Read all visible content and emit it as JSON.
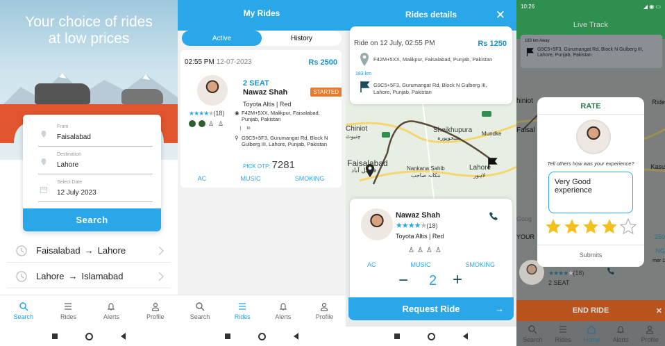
{
  "screen1": {
    "hero_title_line1": "Your choice of rides",
    "hero_title_line2": "at low prices",
    "from_label": "From",
    "from_value": "Faisalabad",
    "destination_label": "Destination",
    "destination_value": "Lahore",
    "date_label": "Select Date",
    "date_value": "12 July 2023",
    "search_button": "Search",
    "recent": [
      {
        "from": "Faisalabad",
        "to": "Lahore"
      },
      {
        "from": "Lahore",
        "to": "Islamabad"
      }
    ],
    "tabs": [
      "Search",
      "Rides",
      "Alerts",
      "Profile"
    ]
  },
  "screen2": {
    "title": "My Rides",
    "seg_active": "Active",
    "seg_history": "History",
    "time": "02:55 PM",
    "date": "12-07-2023",
    "price": "Rs 2500",
    "seats": "2 SEAT",
    "driver": "Nawaz Shah",
    "status": "STARTED",
    "car": "Toyota Altis  |  Red",
    "rating_count": "(18)",
    "from_addr": "F42M+5XX, Malikpur, Faisalabad, Punjab, Pakistan",
    "to_word": "to",
    "to_addr": "G9C5+5F3, Gurumangat Rd, Block N Gulberg III, Lahore, Punjab, Pakistan",
    "otp_label": "PICK OTP:",
    "otp_value": "7281",
    "features": [
      "AC",
      "MUSIC",
      "SMOKING"
    ],
    "tabs": [
      "Search",
      "Rides",
      "Alerts",
      "Profile"
    ]
  },
  "screen3": {
    "title": "Rides details",
    "ride_on": "Ride on 12 July, 02:55 PM",
    "price": "Rs 1250",
    "from_addr": "F42M+5XX, Malikpur, Faisalabad, Punjab, Pakistan",
    "distance": "183 km",
    "to_addr": "G9C5+5F3, Gurumangat Rd, Block N Gulberg III, Lahore, Punjab, Pakistan",
    "map_labels": {
      "chiniot": "Chiniot",
      "chiniot_ur": "چنیوٹ",
      "sheikhupura": "Sheikhupura",
      "sheikhupura_ur": "شیخوپورہ",
      "mundke": "Mundke",
      "faisalabad": "Faisalabad",
      "faisalabad_ur": "فیصل آباد",
      "nankana": "Nankana Sahib",
      "nankana_ur": "ننکانہ صاحب",
      "lahore": "Lahore",
      "lahore_ur": "لاہور"
    },
    "driver": "Nawaz Shah",
    "rating_count": "(18)",
    "car": "Toyota Altis | Red",
    "features": [
      "AC",
      "MUSIC",
      "SMOKING"
    ],
    "seat_count": "2",
    "minus": "−",
    "plus": "+",
    "request_button": "Request Ride",
    "arrow": "→"
  },
  "screen4": {
    "status_time": "10:26",
    "header": "Live Track",
    "distance_away": "183 km Away",
    "addr": "G9C5+5F3, Gurumangat Rd, Block N Gulberg III, Lahore, Punjab, Pakistan",
    "rate_title": "RATE",
    "rate_question": "Tell others how was your experience?",
    "feedback": "Very Good experience",
    "submit": "Submits",
    "seats": "2 SEAT",
    "rating_count": "(18)",
    "end_ride": "END RIDE",
    "tabs": [
      "Search",
      "Rides",
      "Home",
      "Alerts",
      "Profile"
    ],
    "partial_labels": {
      "chiniot": "hiniot",
      "faisal": "Faisal",
      "ride": "Ride",
      "kasur": "Kasu",
      "google": "Goog",
      "your": "YOUR",
      "price": "250",
      "ng": "NG",
      "phone": "mer 1"
    }
  },
  "colors": {
    "primary": "#2aa7e8",
    "started": "#e87c2c",
    "green_bar": "#2e8f4f",
    "end_ride": "#b9541e",
    "star": "#f4c01e"
  }
}
